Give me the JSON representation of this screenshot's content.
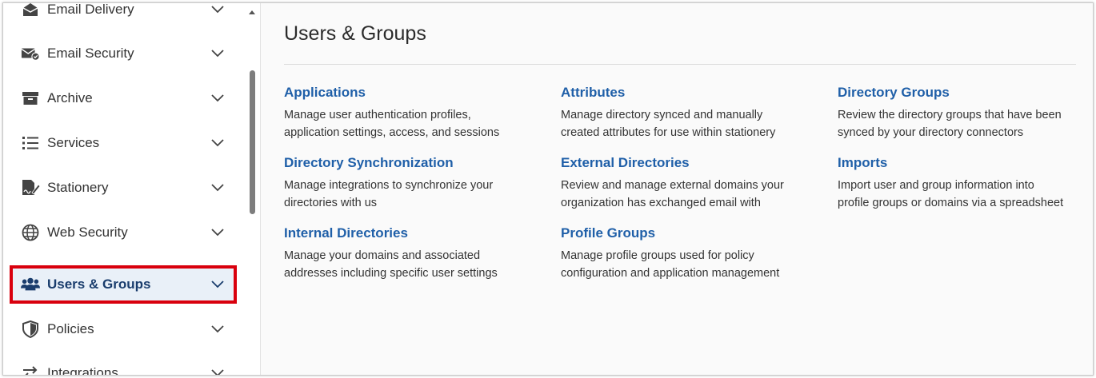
{
  "sidebar": {
    "items": [
      {
        "label": "Email Delivery",
        "icon": "envelope-open-icon"
      },
      {
        "label": "Email Security",
        "icon": "envelope-check-icon"
      },
      {
        "label": "Archive",
        "icon": "archive-box-icon"
      },
      {
        "label": "Services",
        "icon": "list-icon"
      },
      {
        "label": "Stationery",
        "icon": "signature-icon"
      },
      {
        "label": "Web Security",
        "icon": "globe-icon"
      },
      {
        "label": "Users & Groups",
        "icon": "users-icon",
        "active": true
      },
      {
        "label": "Policies",
        "icon": "shield-icon"
      },
      {
        "label": "Integrations",
        "icon": "arrows-icon"
      }
    ]
  },
  "main": {
    "title": "Users & Groups",
    "cards": [
      {
        "title": "Applications",
        "desc_lines": [
          "Manage user authentication profiles,",
          "application settings, access, and sessions"
        ]
      },
      {
        "title": "Attributes",
        "desc_lines": [
          "Manage directory synced and manually",
          "created attributes for use within stationery"
        ]
      },
      {
        "title": "Directory Groups",
        "desc_lines": [
          "Review the directory groups that have been",
          "synced by your directory connectors"
        ]
      },
      {
        "title": "Directory Synchronization",
        "desc_lines": [
          "Manage integrations to synchronize your",
          "directories with us"
        ]
      },
      {
        "title": "External Directories",
        "desc_lines": [
          "Review and manage external domains your",
          "organization has exchanged email with"
        ]
      },
      {
        "title": "Imports",
        "desc_lines": [
          "Import user and group information into",
          "profile groups or domains via a spreadsheet"
        ]
      },
      {
        "title": "Internal Directories",
        "desc_lines": [
          "Manage your domains and associated",
          "addresses including specific user settings"
        ]
      },
      {
        "title": "Profile Groups",
        "desc_lines": [
          "Manage profile groups used for policy",
          "configuration and application management"
        ]
      }
    ]
  },
  "colors": {
    "accent": "#1f5fa8",
    "active_bg": "#e9f0f8",
    "active_label": "#1a3d6d",
    "highlight_border": "#d9000d"
  }
}
